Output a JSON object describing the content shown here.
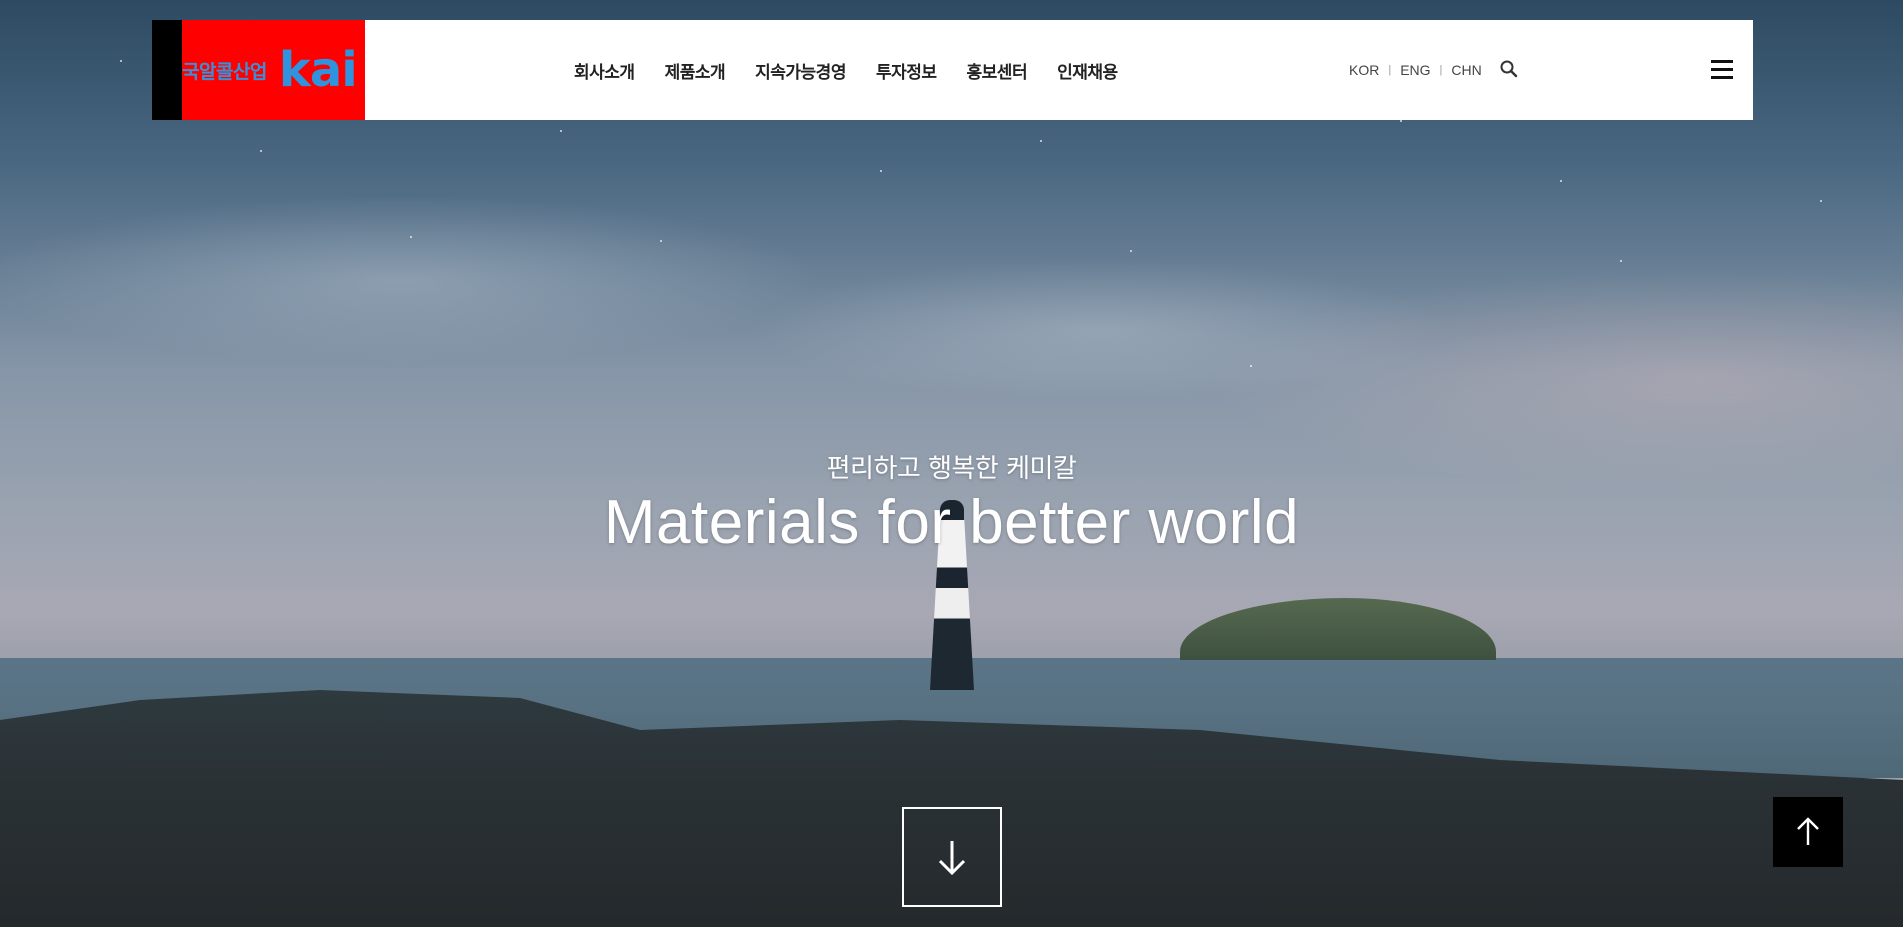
{
  "header": {
    "logo": {
      "korean": "국알콜산업",
      "brand": "kai"
    },
    "nav": [
      {
        "label": "회사소개"
      },
      {
        "label": "제품소개"
      },
      {
        "label": "지속가능경영"
      },
      {
        "label": "투자정보"
      },
      {
        "label": "홍보센터"
      },
      {
        "label": "인재채용"
      }
    ],
    "languages": [
      "KOR",
      "ENG",
      "CHN"
    ],
    "icons": {
      "search": "search-icon",
      "menu": "hamburger-menu-icon"
    }
  },
  "hero": {
    "subtitle": "편리하고 행복한 케미칼",
    "title": "Materials for better world"
  },
  "buttons": {
    "scroll_down_icon": "arrow-down-icon",
    "to_top_icon": "arrow-up-icon"
  },
  "colors": {
    "logo_red": "#ff0000",
    "logo_blue": "#2f93de",
    "header_bg": "#ffffff",
    "to_top_bg": "#000000"
  }
}
